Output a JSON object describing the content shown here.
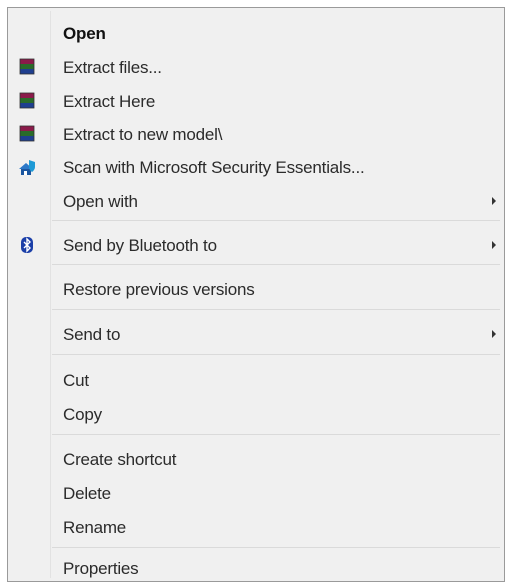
{
  "menu": {
    "open": "Open",
    "extract_files": "Extract files...",
    "extract_here": "Extract Here",
    "extract_to_folder": "Extract to new model\\",
    "scan": "Scan with Microsoft Security Essentials...",
    "open_with": "Open with",
    "send_bluetooth": "Send by Bluetooth to",
    "restore_versions": "Restore previous versions",
    "send_to": "Send to",
    "cut": "Cut",
    "copy": "Copy",
    "create_shortcut": "Create shortcut",
    "delete": "Delete",
    "rename": "Rename",
    "properties": "Properties"
  },
  "icons": {
    "winrar": "winrar-archive-icon",
    "security": "microsoft-security-essentials-icon",
    "bluetooth": "bluetooth-icon",
    "submenu": "submenu-arrow-icon"
  }
}
